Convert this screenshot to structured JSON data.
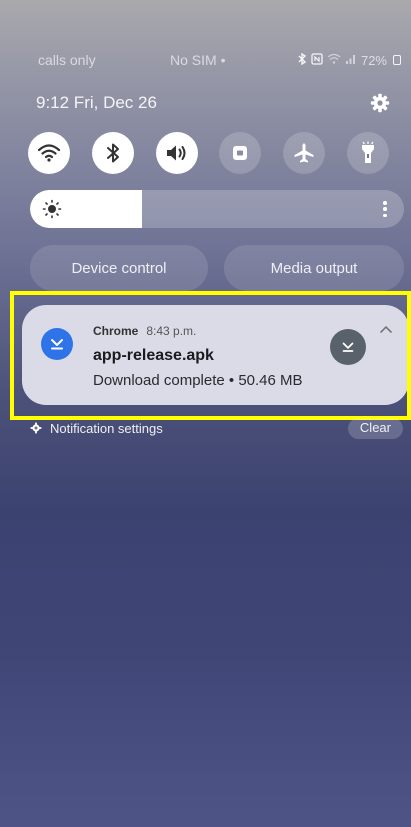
{
  "status_bar": {
    "carrier": "calls only",
    "sim": "No SIM •",
    "battery": "72%"
  },
  "header": {
    "datetime": "9:12  Fri, Dec 26",
    "settings_icon": "gear-icon"
  },
  "quick_toggles": [
    {
      "name": "wifi",
      "icon": "wifi-icon",
      "state": "on"
    },
    {
      "name": "bluetooth",
      "icon": "bluetooth-icon",
      "state": "on"
    },
    {
      "name": "sound",
      "icon": "speaker-icon",
      "state": "on"
    },
    {
      "name": "rotation-lock",
      "icon": "lock-icon",
      "state": "off"
    },
    {
      "name": "airplane-mode",
      "icon": "airplane-icon",
      "state": "off"
    },
    {
      "name": "flashlight",
      "icon": "flashlight-icon",
      "state": "off"
    }
  ],
  "brightness": {
    "level": 0.3
  },
  "buttons": {
    "device_control": "Device control",
    "media_output": "Media output"
  },
  "notification": {
    "app_name": "Chrome",
    "time": "8:43 p.m.",
    "title": "app-release.apk",
    "text": "Download complete • 50.46 MB",
    "app_icon": "download-icon",
    "accent": "#2f73e8",
    "highlight_color": "#ffff00"
  },
  "footer": {
    "settings_label": "Notification settings",
    "clear_label": "Clear"
  }
}
